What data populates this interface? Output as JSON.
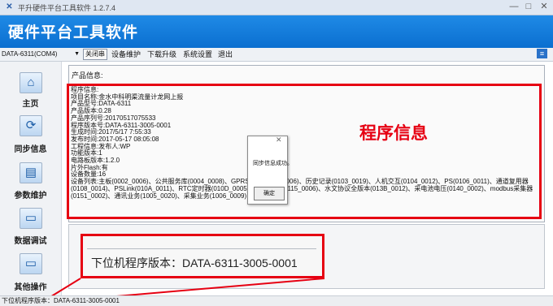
{
  "window": {
    "title": "平升硬件平台工具软件 1.2.7.4",
    "minimize": "—",
    "maximize": "□",
    "close": "✕"
  },
  "header": {
    "title": "硬件平台工具软件"
  },
  "toolbar": {
    "device_select": "DATA-6311(COM4)",
    "close_serial": "关闭串",
    "menu": [
      "设备维护",
      "下载升级",
      "系统设置",
      "退出"
    ]
  },
  "sidebar": {
    "items": [
      {
        "label": "主页",
        "icon": "home-icon"
      },
      {
        "label": "同步信息",
        "icon": "sync-icon"
      },
      {
        "label": "参数维护",
        "icon": "params-icon"
      },
      {
        "label": "数据调试",
        "icon": "monitor-icon"
      },
      {
        "label": "其他操作",
        "icon": "monitor-icon"
      }
    ]
  },
  "product_info": {
    "group_title": "产品信息:",
    "text": "程序信息:\n项目名称:金水中科明渠流量计龙网上报\n产品型号:DATA-6311\n产品版本:0.28\n产品序列号:20170517075533\n程序版本号:DATA-6311-3005-0001\n生成时间:2017/5/17 7:55:33\n发布时间:2017-05-17 08:05:08\n工程信息:发布人:WP\n功能版本:1\n电路板版本:1.2.0\n片外Flash:有\n设备数量:16\n设备列表:主板(0002_0006)、公共服务库(0004_0008)、GPRS(00  ...  22_0006)、历史记录(0103_0019)、人机交互(0104_0012)、PS(0106_0011)、通道复用器(0108_0014)、PSLink(010A_0011)、RTC定时器(010D_0005)、定时采集(0115_0006)、水文协议全版本(013B_0012)、采电池电压(0140_0002)、modbus采集器(0151_0002)、通讯业务(1005_0020)、采集业务(1006_0009)"
  },
  "annotation": {
    "label": "程序信息"
  },
  "dialog": {
    "message": "同步信息成功。",
    "ok": "确定",
    "close": "✕"
  },
  "zoom": {
    "text": "下位机程序版本：DATA-6311-3005-0001"
  },
  "status": {
    "text": "下位机程序版本：DATA-6311-3005-0001"
  }
}
